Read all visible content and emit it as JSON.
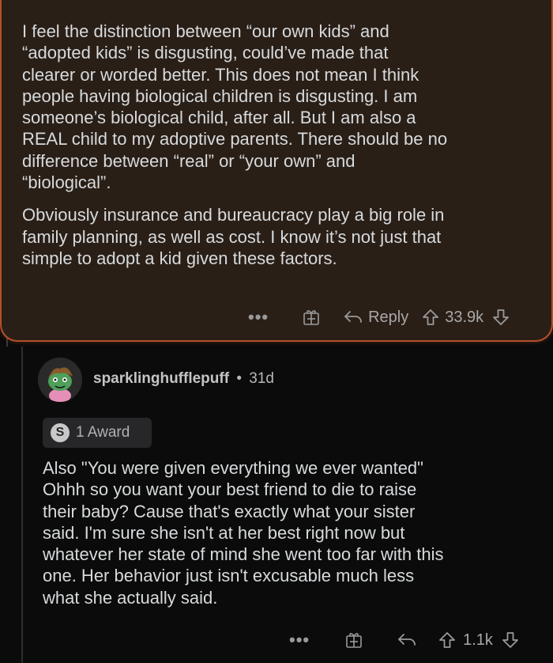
{
  "parent_comment": {
    "paragraphs": [
      "I feel the distinction between “our own kids” and\n“adopted kids” is disgusting, could’ve made that\nclearer or worded better. This does not mean I think\npeople having biological children is disgusting. I am\nsomeone’s biological child, after all. But I am also a\nREAL child to my adoptive parents. There should be no\ndifference between “real” or “your own” and\n“biological”.",
      "Obviously insurance and bureaucracy play a big role in\nfamily planning, as well as cost. I know it’s not just that\nsimple to adopt a kid given these factors."
    ],
    "actions": {
      "more": "•••",
      "reply_label": "Reply",
      "score": "33.9k"
    }
  },
  "reply_comment": {
    "author": "sparklinghufflepuff",
    "separator": "•",
    "age": "31d",
    "award_icon_letter": "S",
    "award_label": "1 Award",
    "text": "Also \"You were given everything we ever wanted\"\nOhhh so you want your best friend to die to raise\ntheir baby? Cause that's exactly what your sister\nsaid. I'm sure she isn't at her best right now but\nwhatever her state of mind she went too far with this\none. Her behavior just isn't excusable much less\nwhat she actually said.",
    "actions": {
      "more": "•••",
      "score": "1.1k"
    }
  },
  "colors": {
    "highlight_bg": "#2a1f17",
    "highlight_border": "#b4502a",
    "page_bg": "#0b0b0b",
    "text": "#d7dadc",
    "muted": "#9a9a9a"
  }
}
